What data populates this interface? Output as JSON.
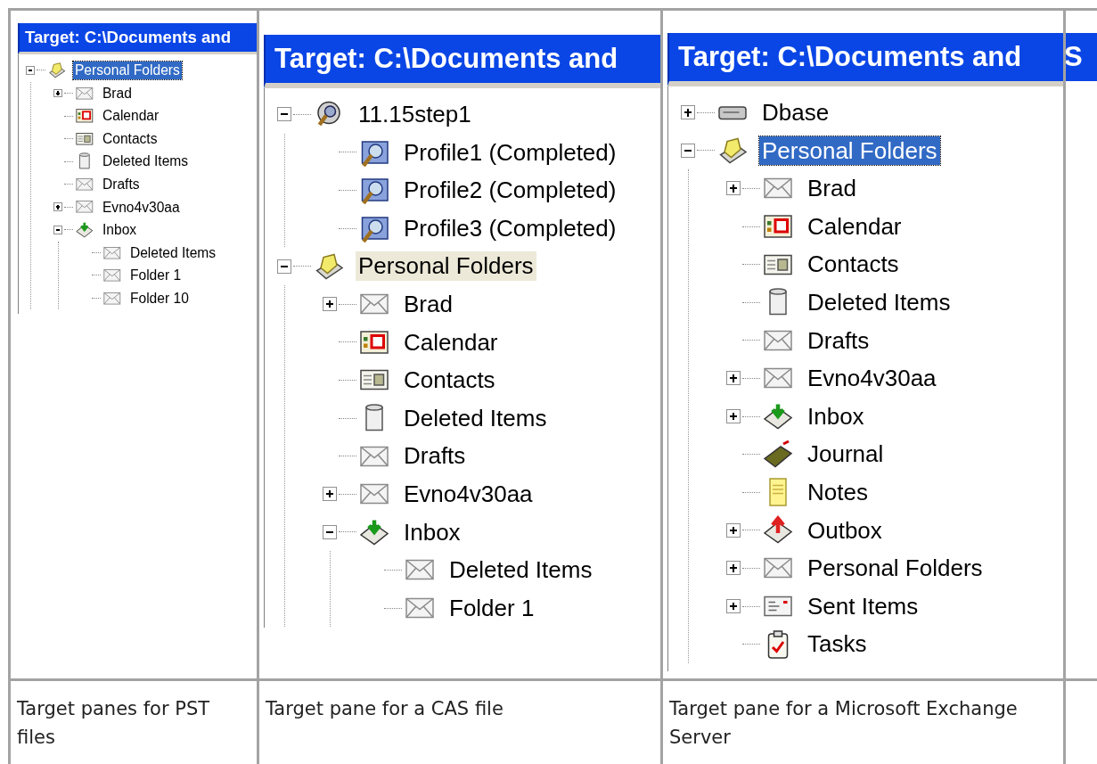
{
  "panes": [
    {
      "title": "Target: C:\\Documents and",
      "focused": true,
      "tree": [
        {
          "label": "Personal Folders",
          "kind": "pst",
          "expanded": true,
          "selected": true,
          "children": [
            {
              "label": "Brad",
              "kind": "mail",
              "expanded": false,
              "selected": false
            },
            {
              "label": "Calendar",
              "kind": "calendar",
              "selected": false
            },
            {
              "label": "Contacts",
              "kind": "contacts",
              "selected": false
            },
            {
              "label": "Deleted Items",
              "kind": "trash",
              "selected": false
            },
            {
              "label": "Drafts",
              "kind": "mail",
              "selected": false
            },
            {
              "label": "Evno4v30aa",
              "kind": "mail",
              "expanded": false,
              "selected": false
            },
            {
              "label": "Inbox",
              "kind": "inbox",
              "expanded": true,
              "selected": false,
              "children": [
                {
                  "label": "Deleted Items",
                  "kind": "mail",
                  "selected": false
                },
                {
                  "label": "Folder 1",
                  "kind": "mail",
                  "selected": false
                },
                {
                  "label": "Folder 10",
                  "kind": "mail",
                  "selected": false
                }
              ]
            }
          ]
        }
      ]
    },
    {
      "title": "Target: C:\\Documents and",
      "focused": false,
      "tree": [
        {
          "label": "11.15step1",
          "kind": "search",
          "expanded": true,
          "selected": false,
          "children": [
            {
              "label": "Profile1 (Completed)",
              "kind": "profile",
              "selected": false
            },
            {
              "label": "Profile2 (Completed)",
              "kind": "profile",
              "selected": false
            },
            {
              "label": "Profile3 (Completed)",
              "kind": "profile",
              "selected": false
            }
          ]
        },
        {
          "label": "Personal Folders",
          "kind": "pst",
          "expanded": true,
          "selected": true,
          "children": [
            {
              "label": "Brad",
              "kind": "mail",
              "expanded": false,
              "selected": false
            },
            {
              "label": "Calendar",
              "kind": "calendar",
              "selected": false
            },
            {
              "label": "Contacts",
              "kind": "contacts",
              "selected": false
            },
            {
              "label": "Deleted Items",
              "kind": "trash",
              "selected": false
            },
            {
              "label": "Drafts",
              "kind": "mail",
              "selected": false
            },
            {
              "label": "Evno4v30aa",
              "kind": "mail",
              "expanded": false,
              "selected": false
            },
            {
              "label": "Inbox",
              "kind": "inbox",
              "expanded": true,
              "selected": false,
              "children": [
                {
                  "label": "Deleted Items",
                  "kind": "mail",
                  "selected": false
                },
                {
                  "label": "Folder 1",
                  "kind": "mail",
                  "selected": false
                }
              ]
            }
          ]
        }
      ]
    },
    {
      "title": "Target: C:\\Documents and",
      "focused": true,
      "tree": [
        {
          "label": "Dbase",
          "kind": "drive",
          "expanded": false,
          "selected": false
        },
        {
          "label": "Personal Folders",
          "kind": "pst",
          "expanded": true,
          "selected": true,
          "children": [
            {
              "label": "Brad",
              "kind": "mail",
              "expanded": false,
              "selected": false
            },
            {
              "label": "Calendar",
              "kind": "calendar",
              "selected": false
            },
            {
              "label": "Contacts",
              "kind": "contacts",
              "selected": false
            },
            {
              "label": "Deleted Items",
              "kind": "trash",
              "selected": false
            },
            {
              "label": "Drafts",
              "kind": "mail",
              "selected": false
            },
            {
              "label": "Evno4v30aa",
              "kind": "mail",
              "expanded": false,
              "selected": false
            },
            {
              "label": "Inbox",
              "kind": "inbox",
              "expanded": false,
              "selected": false
            },
            {
              "label": "Journal",
              "kind": "journal",
              "selected": false
            },
            {
              "label": "Notes",
              "kind": "notes",
              "selected": false
            },
            {
              "label": "Outbox",
              "kind": "outbox",
              "expanded": false,
              "selected": false
            },
            {
              "label": "Personal Folders",
              "kind": "mail",
              "expanded": false,
              "selected": false
            },
            {
              "label": "Sent Items",
              "kind": "sent",
              "expanded": false,
              "selected": false
            },
            {
              "label": "Tasks",
              "kind": "tasks",
              "selected": false
            }
          ]
        }
      ]
    }
  ],
  "title_fragment": "S",
  "captions": [
    "Target panes for PST files",
    "Target pane for a CAS file",
    "Target pane for a Microsoft Exchange Server"
  ]
}
